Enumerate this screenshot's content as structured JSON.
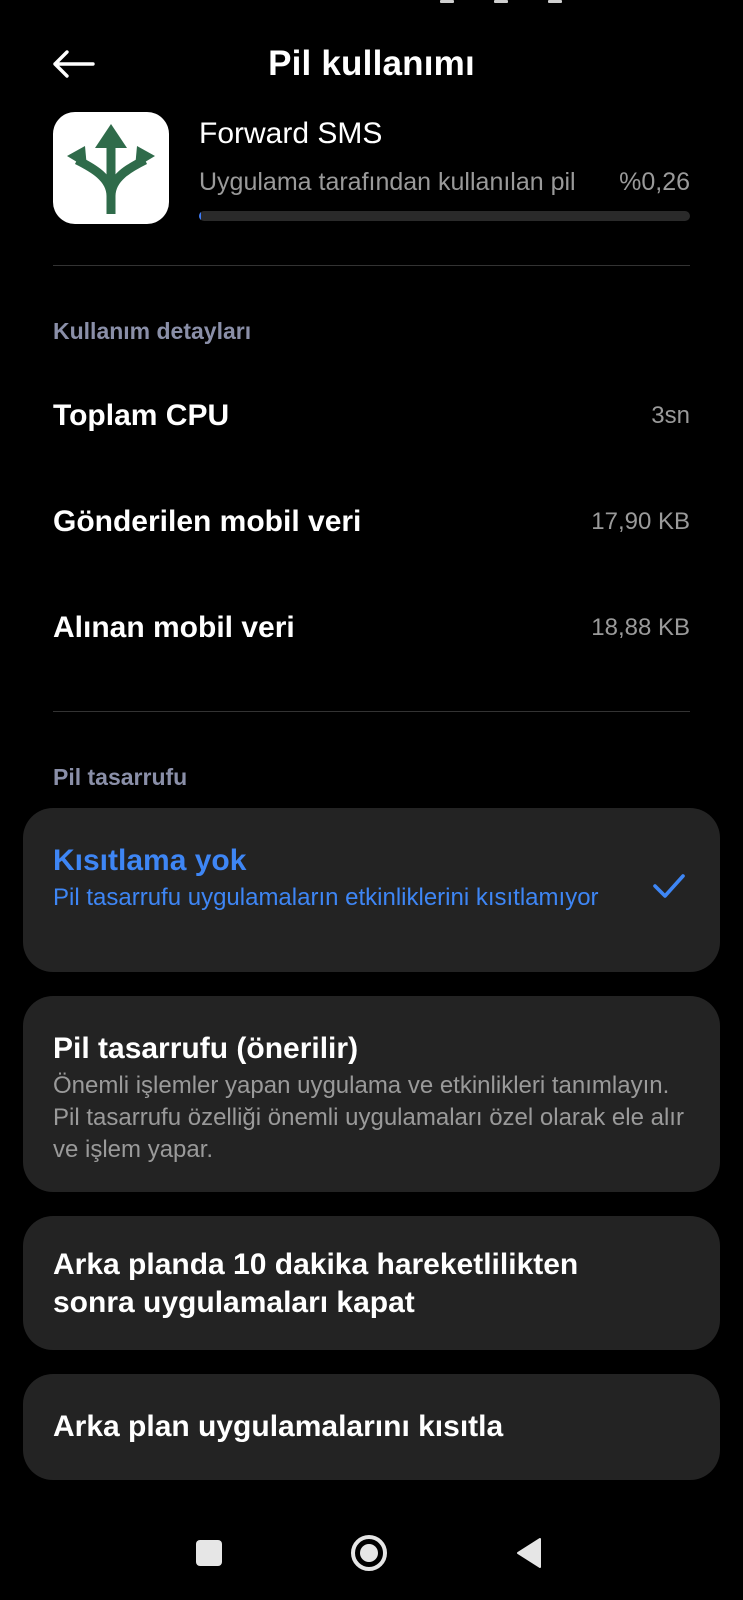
{
  "header": {
    "title": "Pil kullanımı"
  },
  "app": {
    "name": "Forward SMS",
    "usage_label": "Uygulama tarafından kullanılan pil",
    "usage_value": "%0,26",
    "usage_fraction": 0.0026
  },
  "usage_details": {
    "section_title": "Kullanım detayları",
    "rows": [
      {
        "label": "Toplam CPU",
        "value": "3sn"
      },
      {
        "label": "Gönderilen mobil veri",
        "value": "17,90 KB"
      },
      {
        "label": "Alınan mobil veri",
        "value": "18,88 KB"
      }
    ]
  },
  "battery_saver": {
    "section_title": "Pil tasarrufu",
    "options": [
      {
        "title": "Kısıtlama yok",
        "description": "Pil tasarrufu uygulamaların etkinliklerini kısıtlamıyor",
        "selected": true
      },
      {
        "title": "Pil tasarrufu (önerilir)",
        "description": "Önemli işlemler yapan uygulama ve etkinlikleri tanımlayın. Pil tasarrufu özelliği önemli uygulamaları özel olarak ele alır ve işlem yapar.",
        "selected": false
      },
      {
        "title": "Arka planda 10 dakika hareketlilikten sonra uygulamaları kapat",
        "selected": false
      },
      {
        "title": "Arka plan uygulamalarını kısıtla",
        "selected": false
      }
    ]
  },
  "colors": {
    "accent": "#3e86f5",
    "card_bg": "#232323",
    "section_title": "#8a8fa8",
    "app_icon_green": "#2f6b4a"
  },
  "icons": {
    "back": "arrow-left-icon",
    "app": "split-arrows-icon",
    "check": "checkmark-icon",
    "nav_recents": "square-icon",
    "nav_home": "circle-icon",
    "nav_back": "triangle-left-icon"
  }
}
